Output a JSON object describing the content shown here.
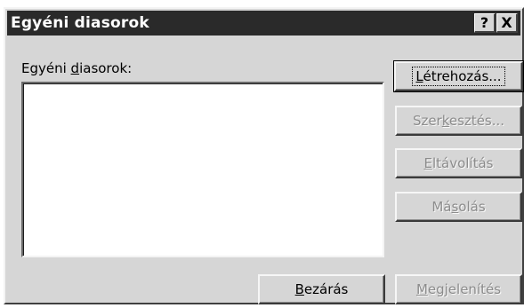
{
  "window": {
    "title": "Egyéni diasorok",
    "help_label": "?",
    "close_label": "X"
  },
  "list": {
    "label_pre": "Egyéni ",
    "label_key": "d",
    "label_post": "iasorok:",
    "items": []
  },
  "buttons": {
    "create": {
      "pre": "",
      "key": "L",
      "post": "étrehozás..."
    },
    "edit": {
      "pre": "Szer",
      "key": "k",
      "post": "esztés..."
    },
    "remove": {
      "pre": "",
      "key": "E",
      "post": "ltávolítás"
    },
    "copy": {
      "pre": "Má",
      "key": "s",
      "post": "olás"
    },
    "close": {
      "pre": "",
      "key": "B",
      "post": "ezárás"
    },
    "show": {
      "pre": "",
      "key": "M",
      "post": "egjelenítés"
    }
  },
  "colors": {
    "titlebar": "#2a2a2a",
    "face": "#d6d6d6",
    "disabled_text": "#8c8c8c"
  }
}
